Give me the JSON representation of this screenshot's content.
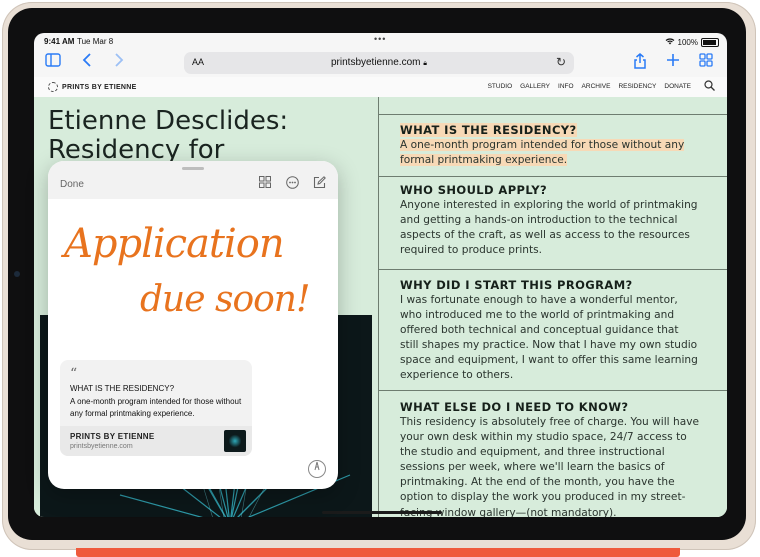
{
  "status": {
    "time": "9:41 AM",
    "date": "Tue Mar 8",
    "battery": "100%"
  },
  "browser": {
    "text_size_label": "AA",
    "url": "printsbyetienne.com",
    "icons": [
      "sidebar-icon",
      "back-icon",
      "forward-icon",
      "share-icon",
      "new-tab-icon",
      "tabs-icon"
    ]
  },
  "site": {
    "brand": "PRINTS BY ETIENNE",
    "nav": [
      "STUDIO",
      "GALLERY",
      "INFO",
      "ARCHIVE",
      "RESIDENCY",
      "DONATE"
    ]
  },
  "page": {
    "title_line1": "Etienne Desclides:",
    "title_line2": "Residency for",
    "sections": [
      {
        "heading": "WHAT IS THE RESIDENCY?",
        "body": "A one-month program intended for those without any formal printmaking experience."
      },
      {
        "heading": "WHO SHOULD APPLY?",
        "body": "Anyone interested in exploring the world of printmaking and getting a hands-on introduction to the technical aspects of the craft, as well as access to the resources required to produce prints."
      },
      {
        "heading": "WHY DID I START THIS PROGRAM?",
        "body": "I was fortunate enough to have a wonderful mentor, who introduced me to the world of printmaking and offered both technical and conceptual guidance that still shapes my practice. Now that I have my own studio space and equipment, I want to offer this same learning experience to others."
      },
      {
        "heading": "WHAT ELSE DO I NEED TO KNOW?",
        "body": "This residency is absolutely free of charge. You will have your own desk within my studio space, 24/7 access to the studio and equipment, and three instructional sessions per week, where we'll learn the basics of printmaking. At the end of the month, you have the option to display the work you produced in my street-facing window gallery—(not mandatory)."
      }
    ]
  },
  "quick_note": {
    "done_label": "Done",
    "handwriting_line1": "Application",
    "handwriting_line2": "due soon!",
    "link": {
      "quote_mark": "“",
      "title": "WHAT IS THE RESIDENCY?",
      "excerpt": "A one-month program intended for those without any formal printmaking experience.",
      "site_name": "PRINTS BY ETIENNE",
      "site_url": "printsbyetienne.com"
    }
  },
  "colors": {
    "page_bg": "#d7ecdb",
    "highlight": "#f7d9b6",
    "ink": "#e8731e",
    "accent": "#2a7bf6",
    "pencil": "#ef5a3c"
  }
}
